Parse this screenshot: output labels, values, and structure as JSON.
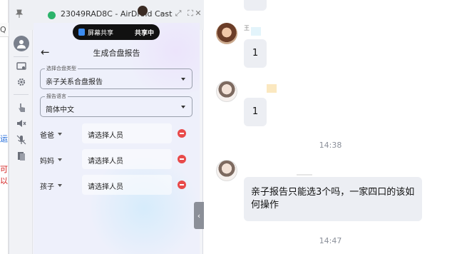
{
  "window": {
    "title": "23049RAD8C - AirDroid Cast",
    "controls": [
      "—",
      "⤢",
      "⛶",
      "✕"
    ]
  },
  "colors": {
    "accent": "#3c8cf0",
    "remove": "#e84a4a",
    "bubble": "#eceef3",
    "status_bar": "#111111"
  },
  "sidebar": {
    "items": [
      {
        "icon": "avatar-icon"
      },
      {
        "icon": "screen-icon"
      },
      {
        "icon": "gear-icon"
      },
      {
        "icon": "touch-icon"
      },
      {
        "icon": "speaker-muted-icon"
      },
      {
        "icon": "mic-muted-icon"
      },
      {
        "icon": "files-icon"
      }
    ]
  },
  "phone": {
    "share_bar": {
      "label": "屏幕共享",
      "status": "共享中"
    },
    "page_title": "生成合盘报告",
    "fields": [
      {
        "legend": "选择合盘类型",
        "value": "亲子关系合盘报告"
      },
      {
        "legend": "报告语言",
        "value": "简体中文"
      }
    ],
    "roles": [
      {
        "role": "爸爸",
        "placeholder": "请选择人员"
      },
      {
        "role": "妈妈",
        "placeholder": "请选择人员"
      },
      {
        "role": "孩子",
        "placeholder": "请选择人员"
      }
    ]
  },
  "background_app": {
    "text1": "运",
    "text2": "可以"
  },
  "chat": {
    "messages": [
      {
        "text": "1"
      },
      {
        "text": "1"
      }
    ],
    "timestamps": [
      "14:38",
      "14:47"
    ],
    "message3": "亲子报告只能选3个吗，一家四口的该如何操作",
    "sender_initial": "王"
  }
}
